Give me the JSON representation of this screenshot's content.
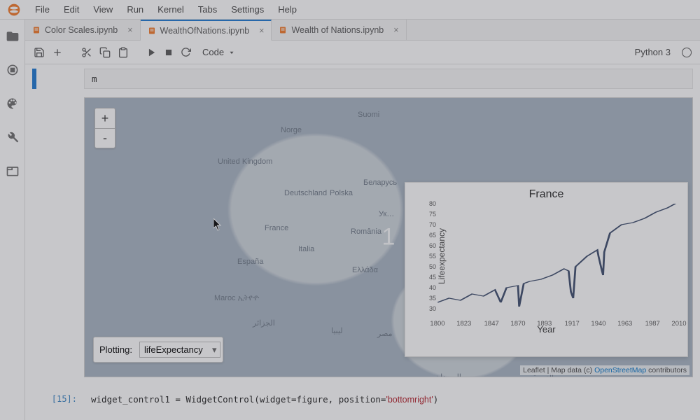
{
  "menu": {
    "items": [
      "File",
      "Edit",
      "View",
      "Run",
      "Kernel",
      "Tabs",
      "Settings",
      "Help"
    ]
  },
  "tabs": [
    {
      "label": "Color Scales.ipynb",
      "active": false
    },
    {
      "label": "WealthOfNations.ipynb",
      "active": true
    },
    {
      "label": "Wealth of Nations.ipynb",
      "active": false
    }
  ],
  "toolbar": {
    "celltype": "Code",
    "kernel": "Python 3"
  },
  "cells": {
    "c0": {
      "prompt": "",
      "code": "m"
    },
    "c1": {
      "prompt": "[15]:",
      "code": "widget_control1 = WidgetControl(widget=figure, position='bottomright')",
      "pos_str": "'bottomright'"
    }
  },
  "map": {
    "zoom_in": "+",
    "zoom_out": "-",
    "plotting_label": "Plotting:",
    "plotting_value": "lifeExpectancy",
    "countries": {
      "suomi": {
        "t": 18,
        "l": 390,
        "label": "Suomi"
      },
      "norge": {
        "t": 40,
        "l": 280,
        "label": "Norge"
      },
      "uk": {
        "t": 85,
        "l": 190,
        "label": "United Kingdom"
      },
      "de": {
        "t": 130,
        "l": 285,
        "label": "Deutschland"
      },
      "by": {
        "t": 115,
        "l": 398,
        "label": "Беларусь"
      },
      "pl": {
        "t": 130,
        "l": 350,
        "label": "Polska"
      },
      "fr": {
        "t": 180,
        "l": 257,
        "label": "France"
      },
      "ua": {
        "t": 160,
        "l": 420,
        "label": "Ук…"
      },
      "ro": {
        "t": 185,
        "l": 380,
        "label": "România"
      },
      "it": {
        "t": 210,
        "l": 305,
        "label": "Italia"
      },
      "es": {
        "t": 228,
        "l": 218,
        "label": "España"
      },
      "gr": {
        "t": 240,
        "l": 382,
        "label": "Ελλάδα"
      },
      "ma": {
        "t": 280,
        "l": 185,
        "label": "Maroc ኢትዮዮ"
      },
      "dz": {
        "t": 315,
        "l": 240,
        "label": "الجزائر"
      },
      "ly": {
        "t": 326,
        "l": 352,
        "label": "ليبيا"
      },
      "eg": {
        "t": 330,
        "l": 418,
        "label": "مصر"
      },
      "sd": {
        "t": 392,
        "l": 500,
        "label": "السودان"
      },
      "ar": {
        "t": 392,
        "l": 640,
        "label": "العربية"
      }
    },
    "attribution": {
      "pre": "Leaflet | Map data (c) ",
      "link": "OpenStreetMap",
      "post": " contributors"
    },
    "center_badge": "1"
  },
  "chart_data": {
    "type": "line",
    "title": "France",
    "xlabel": "Year",
    "ylabel": "Lifeexpectancy",
    "x_ticks": [
      1800,
      1823,
      1847,
      1870,
      1893,
      1917,
      1940,
      1963,
      1987,
      2010
    ],
    "y_ticks": [
      30,
      35,
      40,
      45,
      50,
      55,
      60,
      65,
      70,
      75,
      80
    ],
    "xlim": [
      1800,
      2010
    ],
    "ylim": [
      30,
      80
    ],
    "series": [
      {
        "name": "France",
        "x": [
          1800,
          1810,
          1820,
          1830,
          1840,
          1850,
          1855,
          1860,
          1870,
          1871,
          1875,
          1880,
          1890,
          1900,
          1910,
          1914,
          1916,
          1918,
          1920,
          1930,
          1939,
          1940,
          1943,
          1944,
          1945,
          1950,
          1960,
          1970,
          1980,
          1990,
          2000,
          2010
        ],
        "y": [
          33,
          35,
          34,
          37,
          36,
          39,
          33,
          40,
          41,
          31,
          42,
          43,
          44,
          46,
          49,
          48,
          38,
          35,
          50,
          55,
          58,
          55,
          48,
          46,
          57,
          66,
          70,
          71,
          73,
          76,
          78,
          81
        ]
      }
    ]
  }
}
